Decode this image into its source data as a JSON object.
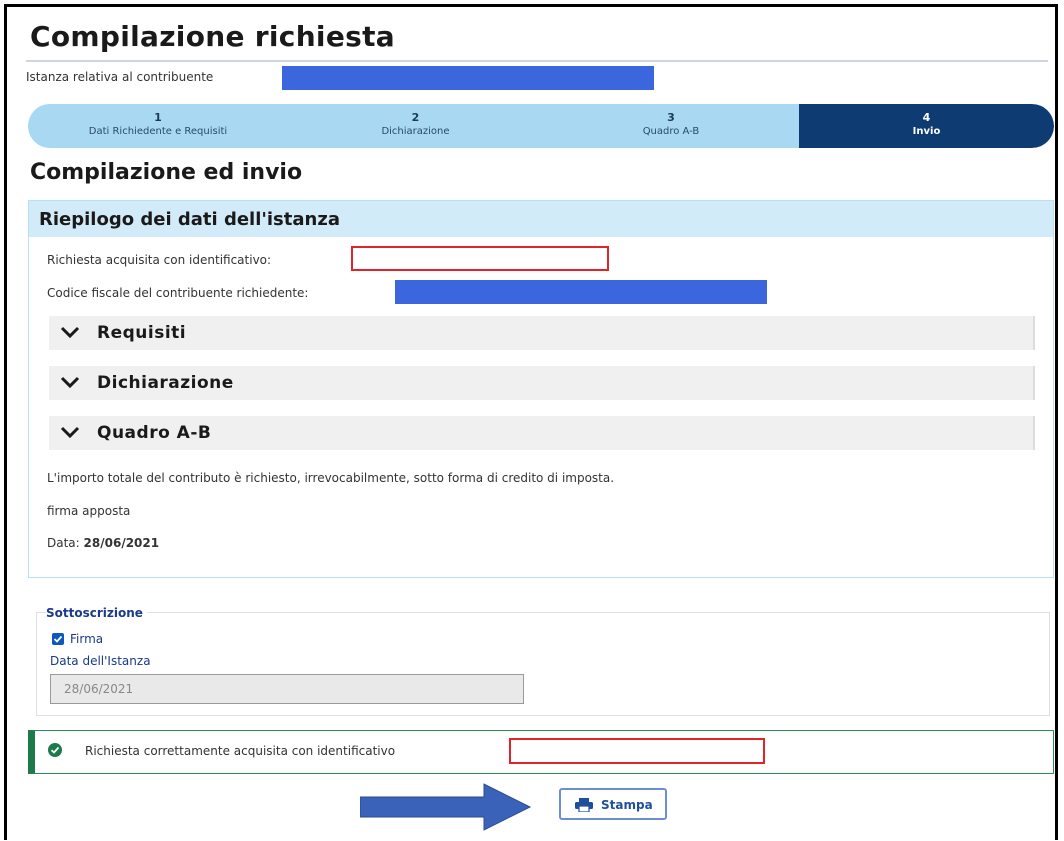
{
  "page": {
    "title": "Compilazione richiesta",
    "contributor_label": "Istanza relativa al contribuente"
  },
  "stepper": {
    "steps": [
      {
        "num": "1",
        "label": "Dati Richiedente e Requisiti"
      },
      {
        "num": "2",
        "label": "Dichiarazione"
      },
      {
        "num": "3",
        "label": "Quadro A-B"
      },
      {
        "num": "4",
        "label": "Invio"
      }
    ],
    "active_index": 3
  },
  "section": {
    "title": "Compilazione ed invio"
  },
  "summary": {
    "header": "Riepilogo dei dati dell'istanza",
    "request_id_label": "Richiesta acquisita con identificativo:",
    "fiscal_code_label": "Codice fiscale del contribuente richiedente:",
    "accordions": [
      {
        "label": "Requisiti"
      },
      {
        "label": "Dichiarazione"
      },
      {
        "label": "Quadro A-B"
      }
    ],
    "statement": "L'importo totale del contributo è richiesto, irrevocabilmente, sotto forma di credito di imposta.",
    "signature_text": "firma apposta",
    "date_label": "Data:",
    "date_value": "28/06/2021"
  },
  "subscription": {
    "legend": "Sottoscrizione",
    "firma_label": "Firma",
    "firma_checked": true,
    "date_label": "Data dell'Istanza",
    "date_value": "28/06/2021"
  },
  "alert": {
    "text": "Richiesta correttamente acquisita con identificativo"
  },
  "actions": {
    "print_label": "Stampa"
  },
  "colors": {
    "stepper_bg": "#a9d8f2",
    "stepper_active": "#0f3b73",
    "summary_header": "#d2ebf9",
    "redaction_blue": "#3b66de",
    "redaction_red": "#e0242a",
    "success": "#1e7a4a",
    "arrow": "#3a62b8"
  },
  "icons": {
    "accordion": "chevron-down-icon",
    "alert": "check-circle-icon",
    "print": "printer-icon",
    "pointer": "right-arrow-icon"
  }
}
